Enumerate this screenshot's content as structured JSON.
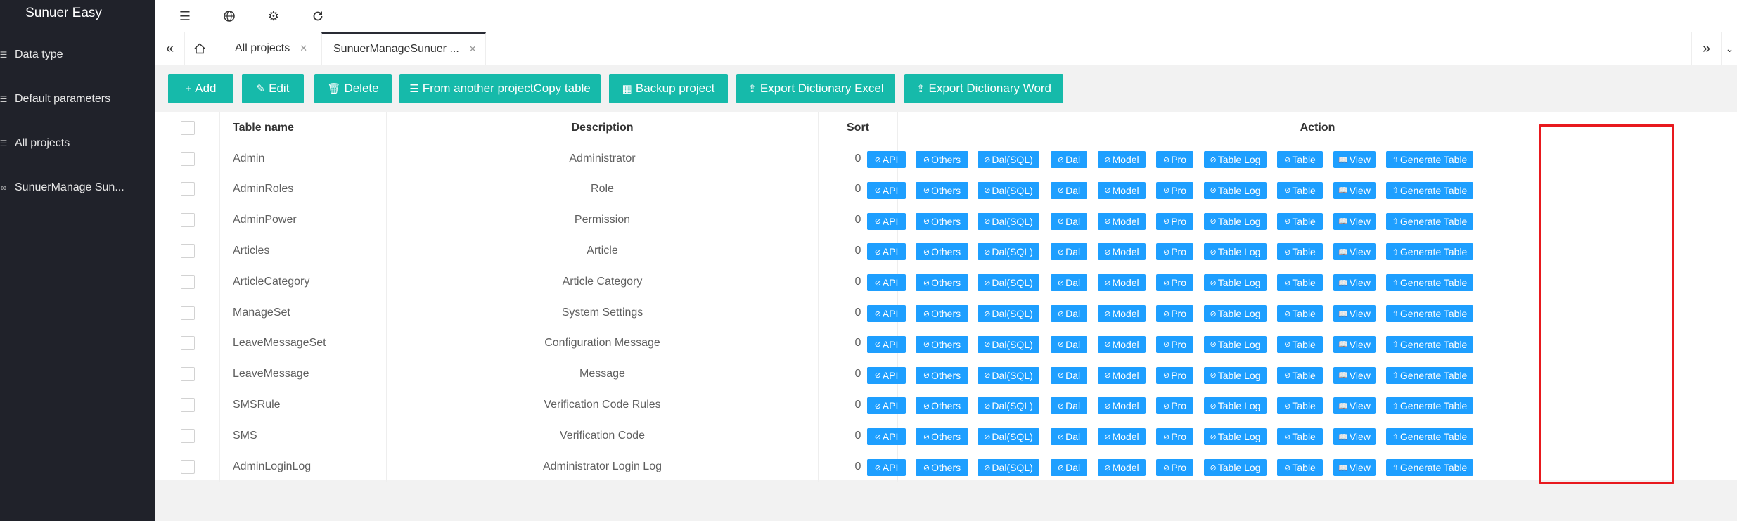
{
  "app": {
    "title": "Sunuer Easy"
  },
  "sidebar": {
    "items": [
      {
        "label": "Data type",
        "icon": "sliders-icon"
      },
      {
        "label": "Default parameters",
        "icon": "sliders-icon"
      },
      {
        "label": "All projects",
        "icon": "sliders-icon"
      },
      {
        "label": "SunuerManage Sun...",
        "icon": "link-icon"
      }
    ]
  },
  "header": {
    "icons": [
      "menu-toggle-icon",
      "globe-icon",
      "settings-icon",
      "refresh-icon"
    ]
  },
  "tabs": {
    "items": [
      {
        "label": "All projects",
        "active": false
      },
      {
        "label": "SunuerManageSunuer ...",
        "active": true
      }
    ]
  },
  "toolbar": {
    "buttons": [
      {
        "label": "Add",
        "icon": "+"
      },
      {
        "label": "Edit",
        "icon": "✎"
      },
      {
        "label": "Delete",
        "icon": "🗑"
      },
      {
        "label": "From another projectCopy table",
        "icon": "☰"
      },
      {
        "label": "Backup project",
        "icon": "▦"
      },
      {
        "label": "Export Dictionary Excel",
        "icon": "⇪"
      },
      {
        "label": "Export Dictionary Word",
        "icon": "⇪"
      }
    ]
  },
  "table": {
    "headers": {
      "name": "Table name",
      "description": "Description",
      "sort": "Sort",
      "action": "Action"
    },
    "action_buttons": [
      "API",
      "Others",
      "Dal(SQL)",
      "Dal",
      "Model",
      "Pro",
      "Table Log",
      "Table",
      "View",
      "Generate Table"
    ],
    "rows": [
      {
        "name": "Admin",
        "description": "Administrator",
        "sort": "0"
      },
      {
        "name": "AdminRoles",
        "description": "Role",
        "sort": "0"
      },
      {
        "name": "AdminPower",
        "description": "Permission",
        "sort": "0"
      },
      {
        "name": "Articles",
        "description": "Article",
        "sort": "0"
      },
      {
        "name": "ArticleCategory",
        "description": "Article Category",
        "sort": "0"
      },
      {
        "name": "ManageSet",
        "description": "System Settings",
        "sort": "0"
      },
      {
        "name": "LeaveMessageSet",
        "description": "Configuration Message",
        "sort": "0"
      },
      {
        "name": "LeaveMessage",
        "description": "Message",
        "sort": "0"
      },
      {
        "name": "SMSRule",
        "description": "Verification Code Rules",
        "sort": "0"
      },
      {
        "name": "SMS",
        "description": "Verification Code",
        "sort": "0"
      },
      {
        "name": "AdminLoginLog",
        "description": "Administrator Login Log",
        "sort": "0"
      }
    ]
  },
  "colors": {
    "sidebar": "#20222a",
    "green": "#16baaa",
    "blue": "#1e9fff",
    "highlight": "#e8191e"
  }
}
